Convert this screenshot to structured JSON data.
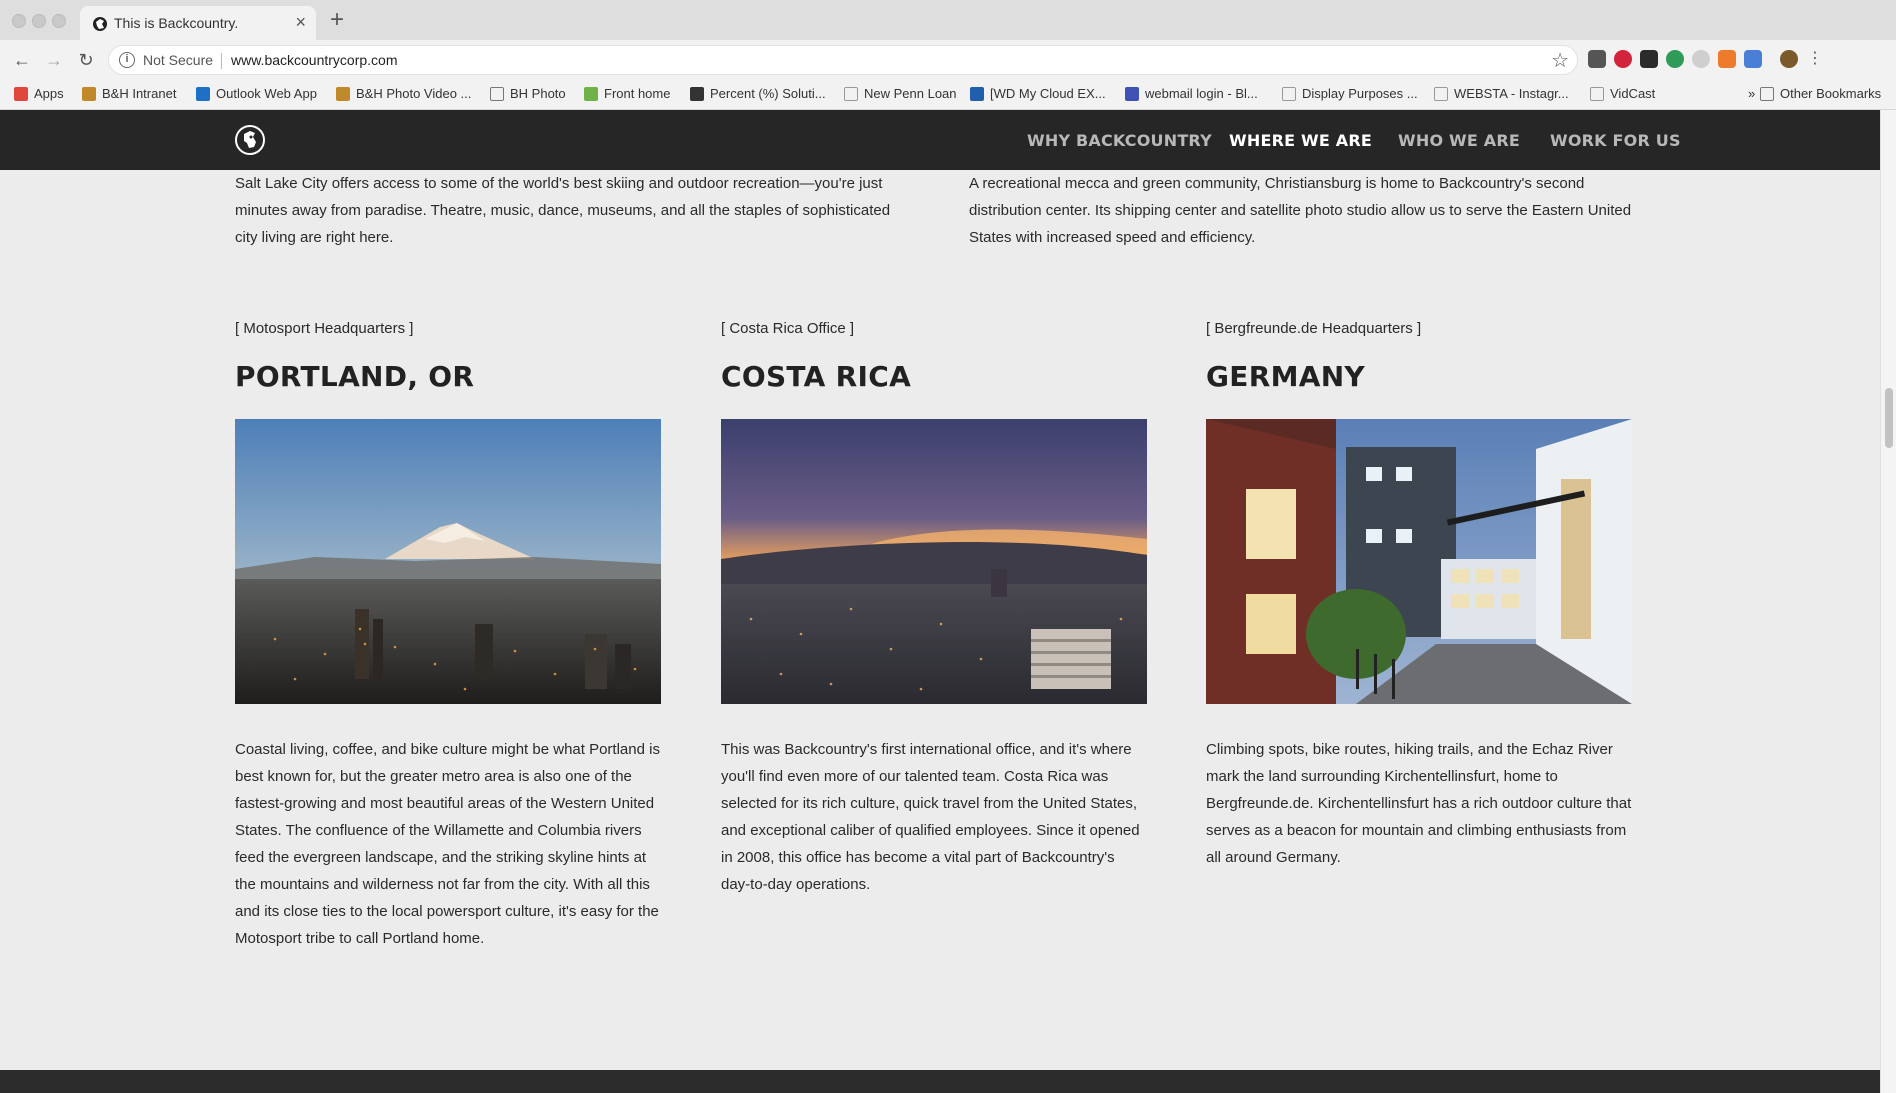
{
  "browser": {
    "tab_title": "This is Backcountry.",
    "tab_close": "×",
    "new_tab": "+",
    "security_label": "Not Secure",
    "url": "www.backcountrycorp.com",
    "bookmarks": [
      {
        "label": "Apps",
        "icon": "apps-grid-icon",
        "color": "#e0483e"
      },
      {
        "label": "B&H Intranet",
        "icon": "bh-icon",
        "color": "#c08a2a"
      },
      {
        "label": "Outlook Web App",
        "icon": "outlook-icon",
        "color": "#1f6fc5"
      },
      {
        "label": "B&H Photo Video ...",
        "icon": "bh-icon",
        "color": "#c08a2a"
      },
      {
        "label": "BH Photo",
        "icon": "folder-icon",
        "color": "#777777"
      },
      {
        "label": "Front home",
        "icon": "front-icon",
        "color": "#6fb24a"
      },
      {
        "label": "Percent (%) Soluti...",
        "icon": "gear-icon",
        "color": "#333333"
      },
      {
        "label": "New Penn Loan",
        "icon": "page-icon",
        "color": "#999999"
      },
      {
        "label": "[WD My Cloud EX...",
        "icon": "wd-icon",
        "color": "#1f5fae"
      },
      {
        "label": "webmail login - Bl...",
        "icon": "grid-icon",
        "color": "#3f51b5"
      },
      {
        "label": "Display Purposes ...",
        "icon": "page-icon",
        "color": "#999999"
      },
      {
        "label": "WEBSTA - Instagr...",
        "icon": "page-icon",
        "color": "#999999"
      },
      {
        "label": "VidCast",
        "icon": "page-icon",
        "color": "#999999"
      }
    ],
    "more_bookmarks": "»",
    "other_bookmarks": "Other Bookmarks"
  },
  "site": {
    "nav": [
      {
        "label": "WHY BACKCOUNTRY",
        "active": false
      },
      {
        "label": "WHERE WE ARE",
        "active": true
      },
      {
        "label": "WHO WE ARE",
        "active": false
      },
      {
        "label": "WORK FOR US",
        "active": false
      }
    ],
    "intro_left": "Salt Lake City offers access to some of the world's best skiing and outdoor recreation—you're just minutes away from paradise. Theatre, music, dance, museums, and all the staples of sophisticated city living are right here.",
    "intro_right": "A recreational mecca and green community, Christiansburg is home to Backcountry's second distribution center. Its shipping center and satellite photo studio allow us to serve the Eastern United States with increased speed and efficiency.",
    "offices": [
      {
        "tag": "[ Motosport Headquarters ]",
        "city": "PORTLAND, OR",
        "photo": "portland-mount-hood-photo",
        "description": "Coastal living, coffee, and bike culture might be what Portland is best known for, but the greater metro area is also one of the fastest-growing and most beautiful areas of the Western United States. The confluence of the Willamette and Columbia rivers feed the evergreen landscape, and the striking skyline hints at the mountains and wilderness not far from the city. With all this and its close ties to the local powersport culture, it's easy for the Motosport tribe to call Portland home."
      },
      {
        "tag": "[ Costa Rica Office ]",
        "city": "COSTA RICA",
        "photo": "costa-rica-city-sunset-photo",
        "description": "This was Backcountry's first international office, and it's where you'll find even more of our talented team. Costa Rica was selected for its rich culture, quick travel from the United States, and exceptional caliber of qualified employees. Since it opened in 2008, this office has become a vital part of Backcountry's day-to-day operations."
      },
      {
        "tag": "[ Bergfreunde.de Headquarters ]",
        "city": "GERMANY",
        "photo": "germany-office-building-photo",
        "description": "Climbing spots, bike routes, hiking trails, and the Echaz River mark the land surrounding Kirchentellinsfurt, home to Bergfreunde.de. Kirchentellinsfurt has a rich outdoor culture that serves as a beacon for mountain and climbing enthusiasts from all around Germany."
      }
    ]
  }
}
